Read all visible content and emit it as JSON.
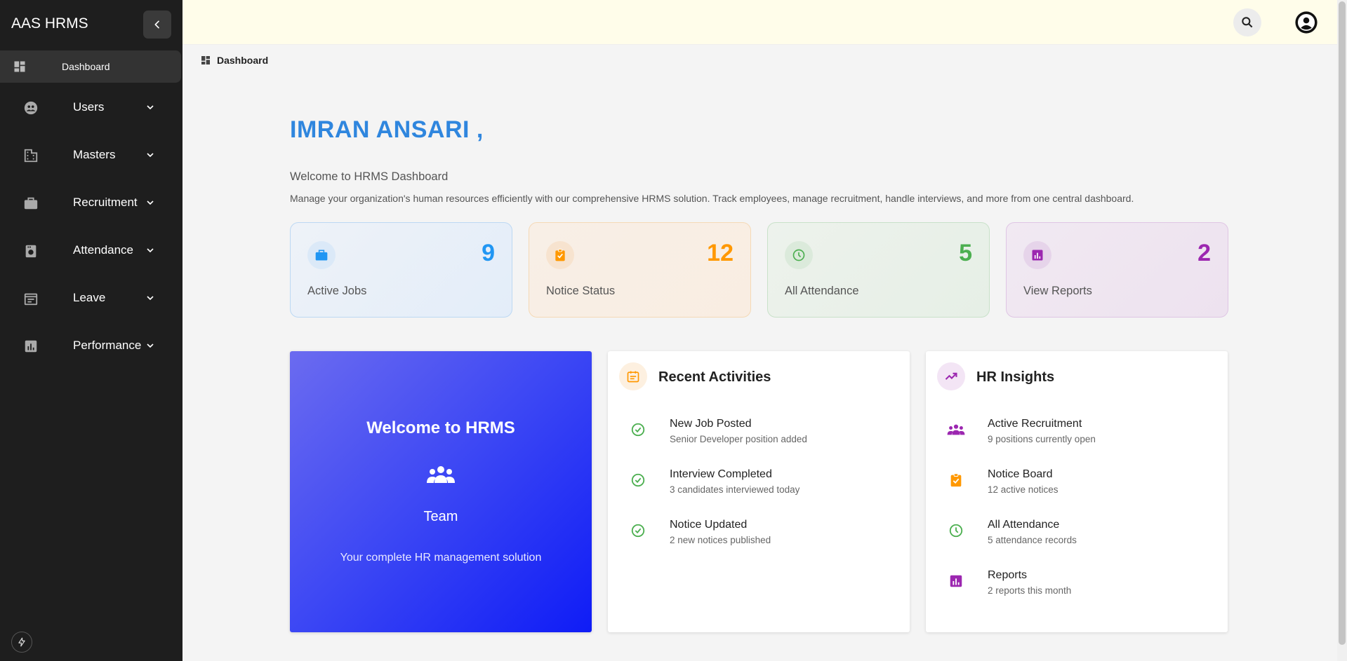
{
  "app": {
    "brand": "AAS HRMS"
  },
  "sidebar": {
    "active": {
      "label": "Dashboard",
      "icon": "dashboard-icon"
    },
    "items": [
      {
        "label": "Users",
        "icon": "users-icon"
      },
      {
        "label": "Masters",
        "icon": "building-icon"
      },
      {
        "label": "Recruitment",
        "icon": "briefcase-icon"
      },
      {
        "label": "Attendance",
        "icon": "attendance-icon"
      },
      {
        "label": "Leave",
        "icon": "leave-icon"
      },
      {
        "label": "Performance",
        "icon": "chart-icon"
      }
    ]
  },
  "breadcrumb": {
    "label": "Dashboard"
  },
  "header": {
    "greeting": "IMRAN ANSARI ,",
    "welcome": "Welcome to HRMS Dashboard",
    "description": "Manage your organization's human resources efficiently with our comprehensive HRMS solution. Track employees, manage recruitment, handle interviews, and more from one central dashboard."
  },
  "stats": [
    {
      "label": "Active Jobs",
      "value": "9",
      "color": "#2196f3",
      "icon": "briefcase-icon"
    },
    {
      "label": "Notice Status",
      "value": "12",
      "color": "#ff9800",
      "icon": "clipboard-check-icon"
    },
    {
      "label": "All Attendance",
      "value": "5",
      "color": "#4caf50",
      "icon": "clock-icon"
    },
    {
      "label": "View Reports",
      "value": "2",
      "color": "#9c27b0",
      "icon": "report-icon"
    }
  ],
  "hero": {
    "title": "Welcome to HRMS",
    "team": "Team",
    "caption": "Your complete HR management solution"
  },
  "recent": {
    "title": "Recent Activities",
    "items": [
      {
        "title": "New Job Posted",
        "sub": "Senior Developer position added"
      },
      {
        "title": "Interview Completed",
        "sub": "3 candidates interviewed today"
      },
      {
        "title": "Notice Updated",
        "sub": "2 new notices published"
      }
    ]
  },
  "insights": {
    "title": "HR Insights",
    "items": [
      {
        "title": "Active Recruitment",
        "sub": "9 positions currently open",
        "icon": "group-icon"
      },
      {
        "title": "Notice Board",
        "sub": "12 active notices",
        "icon": "clipboard-check-icon"
      },
      {
        "title": "All Attendance",
        "sub": "5 attendance records",
        "icon": "clock-icon"
      },
      {
        "title": "Reports",
        "sub": "2 reports this month",
        "icon": "report-icon"
      }
    ]
  }
}
